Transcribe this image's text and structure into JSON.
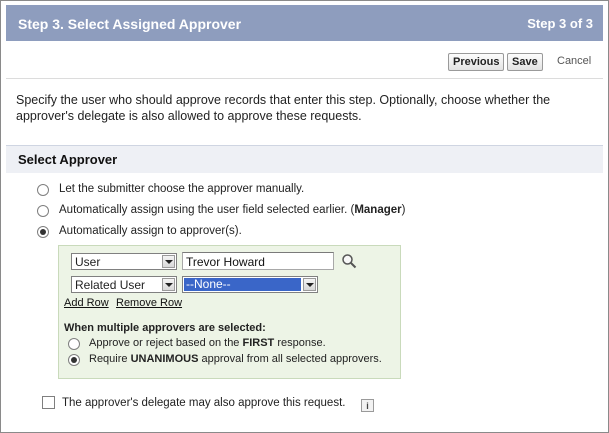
{
  "header": {
    "title": "Step 3. Select Assigned Approver",
    "step": "Step 3 of 3"
  },
  "buttons": {
    "previous": "Previous",
    "save": "Save",
    "cancel": "Cancel"
  },
  "description": "Specify the user who should approve records that enter this step. Optionally, choose whether the approver's delegate is also allowed to approve these requests.",
  "section": {
    "title": "Select Approver"
  },
  "options": [
    {
      "text": "Let the submitter choose the approver manually.",
      "checked": false
    },
    {
      "text_pre": "Automatically assign using the user field selected earlier. (",
      "text_bold": "Manager",
      "text_post": ")",
      "checked": false
    },
    {
      "text": "Automatically assign to approver(s).",
      "checked": true
    }
  ],
  "approver_rows": {
    "row1": {
      "type": "User",
      "value": "Trevor Howard"
    },
    "row2": {
      "type": "Related User",
      "value": "--None--"
    },
    "add_row": "Add Row",
    "remove_row": "Remove Row"
  },
  "multiple": {
    "heading": "When multiple approvers are selected:",
    "option1": {
      "pre": "Approve or reject based on the ",
      "bold": "FIRST",
      "post": " response.",
      "checked": false
    },
    "option2": {
      "pre": "Require ",
      "bold": "UNANIMOUS",
      "post": " approval from all selected approvers.",
      "checked": true
    }
  },
  "delegate": {
    "text": "The approver's delegate may also approve this request.",
    "checked": false,
    "info_icon": "i"
  },
  "colors": {
    "header_bg": "#8e9dbe",
    "panel_bg": "#edf4e6",
    "selection": "#3a66c8"
  }
}
